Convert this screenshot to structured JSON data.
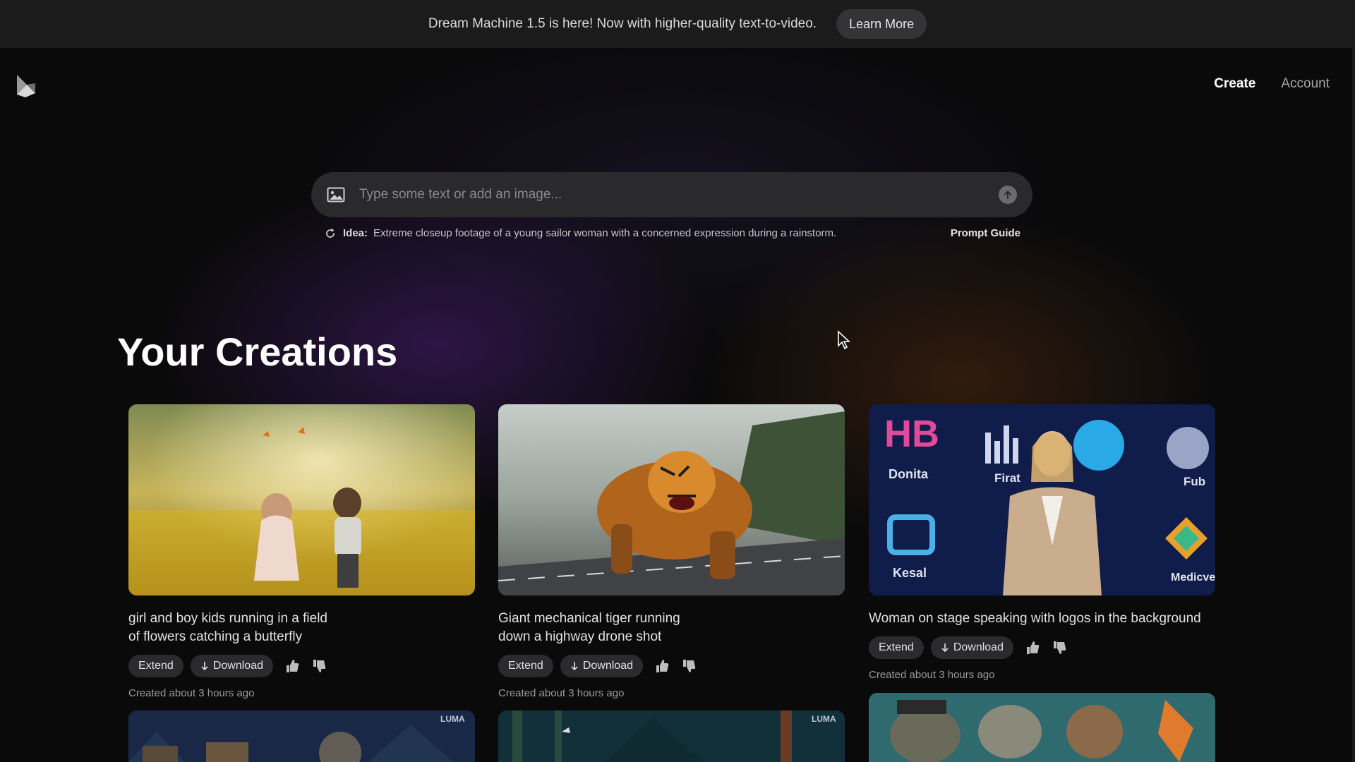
{
  "banner": {
    "text": "Dream Machine 1.5 is here! Now with higher-quality text-to-video.",
    "button": "Learn More"
  },
  "header": {
    "logo_icon": "luma-logo-icon",
    "nav": {
      "create": "Create",
      "account": "Account"
    }
  },
  "prompt": {
    "placeholder": "Type some text or add an image...",
    "image_icon": "image-icon",
    "send_icon": "arrow-up-icon"
  },
  "idea": {
    "label": "Idea:",
    "text": "Extreme closeup footage of a young sailor woman with a concerned expression during a rainstorm.",
    "guide": "Prompt Guide"
  },
  "section_title": "Your Creations",
  "cards": [
    {
      "caption_line1": "girl and boy kids running in a field",
      "caption_line2": "of flowers catching a butterfly",
      "extend": "Extend",
      "download": "Download",
      "meta": "Created about 3 hours ago"
    },
    {
      "caption_line1": "Giant mechanical tiger running",
      "caption_line2": "down a highway drone shot",
      "extend": "Extend",
      "download": "Download",
      "meta": "Created about 3 hours ago"
    },
    {
      "caption_line1": "Woman on stage speaking with logos in the background",
      "caption_line2": "",
      "extend": "Extend",
      "download": "Download",
      "meta": "Created about 3 hours ago",
      "logo_labels": [
        "Donita",
        "Firat",
        "Fub",
        "Kesal",
        "Medicve"
      ]
    }
  ],
  "watermark": "LUMA",
  "colors": {
    "banner_bg": "#1b1b1c",
    "pill_bg": "#2b2b2d",
    "prompt_bg": "#2a2a2d"
  }
}
